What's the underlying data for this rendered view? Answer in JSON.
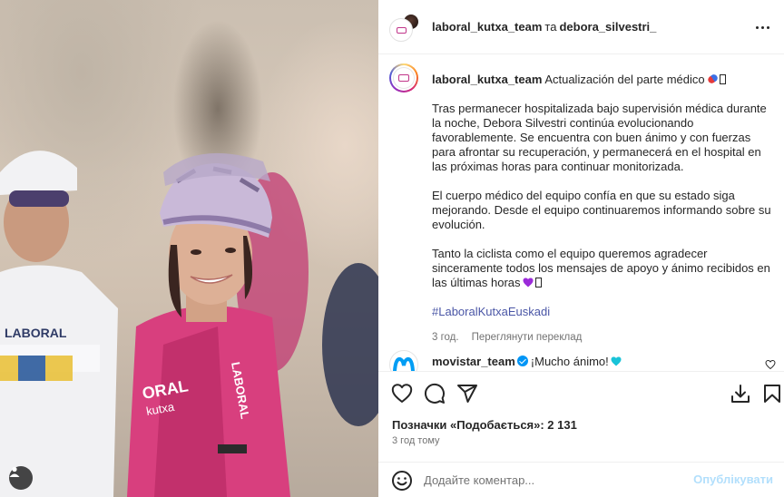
{
  "header": {
    "author_primary": "laboral_kutxa_team",
    "conjunction": "та",
    "author_collab": "debora_silvestri_",
    "more_icon": "more-horizontal-icon"
  },
  "caption": {
    "username": "laboral_kutxa_team",
    "title": "Actualización del parte médico",
    "p1": "Tras permanecer hospitalizada bajo supervisión médica durante la noche, Debora Silvestri continúa evolucionando favorablemente. Se encuentra con buen ánimo y con fuerzas para afrontar su recuperación, y permanecerá en el hospital en las próximas horas para continuar monitorizada.",
    "p2": "El cuerpo médico del equipo confía en que su estado siga mejorando. Desde el equipo continuaremos informando sobre su evolución.",
    "p3": "Tanto la ciclista como el equipo queremos agradecer sinceramente todos los mensajes de apoyo y ánimo recibidos en las últimas horas",
    "hashtag": "#LaboralKutxaEuskadi",
    "age": "3 год.",
    "translate": "Переглянути переклад"
  },
  "comment": {
    "username": "movistar_team",
    "text": "¡Mucho ánimo!"
  },
  "actions": {
    "likes_label": "Позначки «Подобається»: 2 131",
    "timestamp": "3 год тому"
  },
  "composer": {
    "placeholder": "Додайте коментар...",
    "post_label": "Опублікувати"
  },
  "colors": {
    "accent": "#0095f6",
    "hashtag": "#4a56a6",
    "post_disabled": "#b2dffc",
    "muted": "#737373"
  }
}
